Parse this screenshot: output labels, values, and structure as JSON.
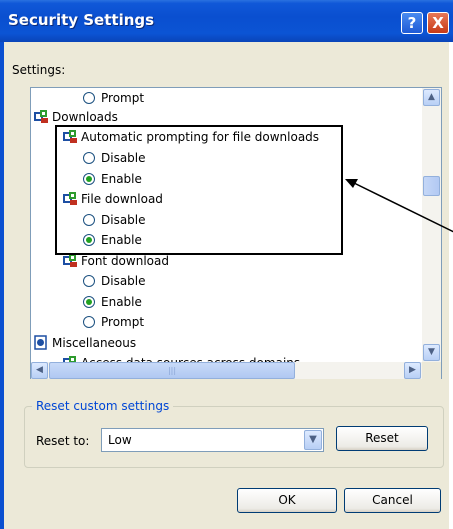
{
  "window": {
    "title": "Security Settings",
    "help_glyph": "?",
    "close_glyph": "X"
  },
  "settings_label": "Settings:",
  "list": {
    "rows": [
      {
        "kind": "radio",
        "label": "Prompt",
        "selected": false
      },
      {
        "kind": "header",
        "label": "Downloads",
        "icon": "settings-category-icon"
      },
      {
        "kind": "subheader",
        "label": "Automatic prompting for file downloads",
        "icon": "settings-category-icon"
      },
      {
        "kind": "radio",
        "label": "Disable",
        "selected": false
      },
      {
        "kind": "radio",
        "label": "Enable",
        "selected": true
      },
      {
        "kind": "subheader",
        "label": "File download",
        "icon": "settings-category-icon"
      },
      {
        "kind": "radio",
        "label": "Disable",
        "selected": false
      },
      {
        "kind": "radio",
        "label": "Enable",
        "selected": true
      },
      {
        "kind": "subheader",
        "label": "Font download",
        "icon": "settings-category-icon"
      },
      {
        "kind": "radio",
        "label": "Disable",
        "selected": false
      },
      {
        "kind": "radio",
        "label": "Enable",
        "selected": true
      },
      {
        "kind": "radio",
        "label": "Prompt",
        "selected": false
      },
      {
        "kind": "header",
        "label": "Miscellaneous",
        "icon": "miscellaneous-icon"
      },
      {
        "kind": "subheader",
        "label": "Access data sources across domains",
        "icon": "settings-category-icon"
      }
    ]
  },
  "reset_group": {
    "title": "Reset custom settings",
    "reset_to_label": "Reset to:",
    "reset_to_value": "Low",
    "reset_button": "Reset"
  },
  "buttons": {
    "ok": "OK",
    "cancel": "Cancel"
  },
  "colors": {
    "titlebar": "#0a4fd0",
    "radio_selected": "#21a121",
    "group_title": "#0046d5"
  }
}
